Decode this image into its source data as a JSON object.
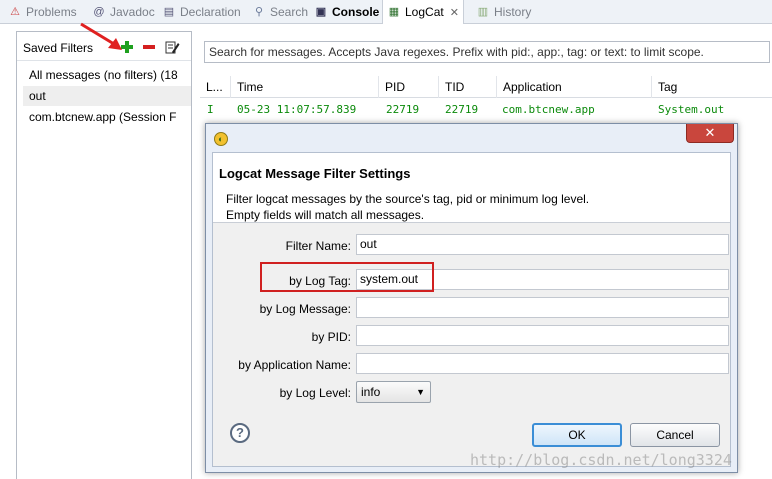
{
  "tabs": [
    {
      "label": "Problems",
      "icon": "problems-icon"
    },
    {
      "label": "Javadoc",
      "icon": "javadoc-icon"
    },
    {
      "label": "Declaration",
      "icon": "declaration-icon"
    },
    {
      "label": "Search",
      "icon": "search-icon"
    },
    {
      "label": "Console",
      "icon": "console-icon"
    },
    {
      "label": "LogCat",
      "icon": "logcat-icon",
      "active": true
    },
    {
      "label": "History",
      "icon": "history-icon"
    }
  ],
  "saved_filters": {
    "title": "Saved Filters",
    "items": [
      {
        "label": "All messages (no filters) (18"
      },
      {
        "label": "out",
        "selected": true
      },
      {
        "label": "com.btcnew.app (Session F"
      }
    ]
  },
  "search": {
    "placeholder": "Search for messages. Accepts Java regexes. Prefix with pid:, app:, tag: or text: to limit scope."
  },
  "table": {
    "columns": [
      "L...",
      "Time",
      "PID",
      "TID",
      "Application",
      "Tag"
    ],
    "rows": [
      {
        "level": "I",
        "time": "05-23 11:07:57.839",
        "pid": "22719",
        "tid": "22719",
        "app": "com.btcnew.app",
        "tag": "System.out"
      }
    ]
  },
  "dialog": {
    "close_glyph": "✕",
    "title": "Logcat Message Filter Settings",
    "description": [
      "Filter logcat messages by the source's tag, pid or minimum log level.",
      "Empty fields will match all messages."
    ],
    "fields": {
      "filter_name": {
        "label": "Filter Name:",
        "value": "out"
      },
      "log_tag": {
        "label": "by Log Tag:",
        "value": "system.out"
      },
      "log_message": {
        "label": "by Log Message:",
        "value": ""
      },
      "pid": {
        "label": "by PID:",
        "value": ""
      },
      "app_name": {
        "label": "by Application Name:",
        "value": ""
      },
      "log_level": {
        "label": "by Log Level:",
        "value": "info"
      }
    },
    "help_glyph": "?",
    "ok_label": "OK",
    "cancel_label": "Cancel"
  },
  "watermark": "http://blog.csdn.net/long3324",
  "colors": {
    "log_info": "#0b8a0b",
    "highlight": "#d02020",
    "default_button": "#3b8ed6"
  }
}
